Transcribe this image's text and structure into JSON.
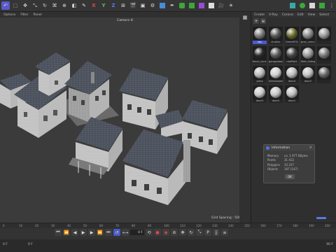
{
  "menubar": {
    "items": [
      "Options",
      "Filter",
      "Panel"
    ]
  },
  "viewport": {
    "title": "Camera ©",
    "grid_spacing": "Grid Spacing : 500 cm"
  },
  "material_manager": {
    "menu": [
      "Create",
      "V-Ray",
      "Corona",
      "Edit",
      "View",
      "Select"
    ],
    "materials": [
      {
        "label": "sky",
        "active": true,
        "color": "#7a7a7a"
      },
      {
        "label": "shutter",
        "active": false,
        "color": "#555555"
      },
      {
        "label": "GreenPOL",
        "active": false,
        "color": "#6b6a2a"
      },
      {
        "label": "grey_concre",
        "active": false,
        "color": "#8a8a8a"
      },
      {
        "label": "",
        "active": false,
        "color": "#9a9a9a"
      },
      {
        "label": "black_concr",
        "active": false,
        "color": "#2a2a2a"
      },
      {
        "label": "garagedoor",
        "active": false,
        "color": "#5a5a5a"
      },
      {
        "label": "roofRat1",
        "active": false,
        "color": "#444444"
      },
      {
        "label": "Wall_Siding",
        "active": false,
        "color": "#9a9a9a"
      },
      {
        "label": "",
        "active": false,
        "color": "#777777"
      },
      {
        "label": "glass",
        "active": false,
        "color": "#b8b8b8"
      },
      {
        "label": "wilndowpost",
        "active": false,
        "color": "#d0d0d0"
      },
      {
        "label": "door4",
        "active": false,
        "color": "#bdbdbd"
      },
      {
        "label": "door2",
        "active": false,
        "color": "#c2c2c2"
      },
      {
        "label": "",
        "active": false,
        "color": "#666666"
      },
      {
        "label": "door3",
        "active": false,
        "color": "#c8c8c8"
      },
      {
        "label": "door5",
        "active": false,
        "color": "#c4c4c4"
      },
      {
        "label": "door1",
        "active": false,
        "color": "#c0c0c0"
      }
    ]
  },
  "info_dialog": {
    "title": "Information",
    "rows": [
      {
        "key": "Memory",
        "value": "ca. 1 977 KBytes"
      },
      {
        "key": "Points",
        "value": "31 412"
      },
      {
        "key": "Polygons",
        "value": "33 237"
      },
      {
        "key": "Objects",
        "value": "187 (147)"
      }
    ],
    "ok_label": "OK"
  },
  "timeline": {
    "ruler": [
      "0",
      "10",
      "20",
      "30",
      "40",
      "50",
      "60",
      "70",
      "80",
      "90",
      "100",
      "110",
      "120",
      "130",
      "140",
      "150",
      "160",
      "170",
      "180",
      "190",
      "200"
    ],
    "current_frame": "0 F",
    "bottom_left": "0 F",
    "bottom_mid": "0 F",
    "bottom_right": "90 F"
  },
  "colors": {
    "accent": "#5a5ac8",
    "record": "#e04848"
  }
}
